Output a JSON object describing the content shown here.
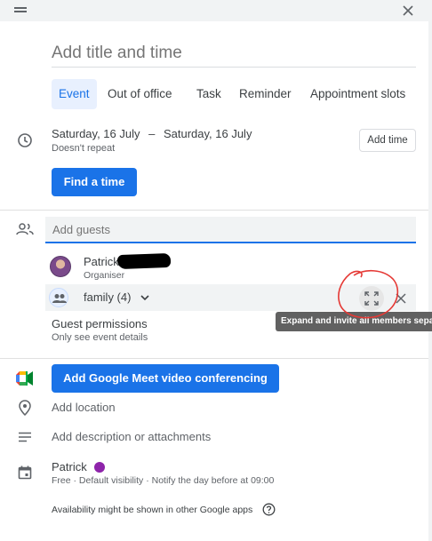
{
  "title_placeholder": "Add title and time",
  "tabs": [
    {
      "label": "Event",
      "active": true
    },
    {
      "label": "Out of office",
      "active": false
    },
    {
      "label": "Task",
      "active": false
    },
    {
      "label": "Reminder",
      "active": false
    },
    {
      "label": "Appointment slots",
      "active": false
    }
  ],
  "date": {
    "start": "Saturday, 16 July",
    "separator": "–",
    "end": "Saturday, 16 July",
    "repeat": "Doesn't repeat",
    "add_time_label": "Add time"
  },
  "find_time_label": "Find a time",
  "guests": {
    "placeholder": "Add guests",
    "organiser": {
      "name": "Patrick",
      "role": "Organiser"
    },
    "group": {
      "label": "family (4)"
    },
    "tooltip": "Expand and invite all members separately",
    "permissions_title": "Guest permissions",
    "permissions_detail": "Only see event details"
  },
  "meet_button_label": "Add Google Meet video conferencing",
  "location_placeholder": "Add location",
  "description_placeholder": "Add description or attachments",
  "calendar": {
    "owner": "Patrick",
    "details": "Free · Default visibility · Notify the day before at 09:00",
    "color": "#8e24aa"
  },
  "footer_note": "Availability might be shown in other Google apps",
  "colors": {
    "accent": "#1a73e8",
    "annotation": "#e53935"
  },
  "icons": [
    "drag-handle-icon",
    "close-icon",
    "clock-icon",
    "people-icon",
    "group-icon",
    "chevron-down-icon",
    "expand-icon",
    "remove-icon",
    "google-meet-icon",
    "location-pin-icon",
    "description-icon",
    "calendar-icon",
    "help-icon"
  ]
}
